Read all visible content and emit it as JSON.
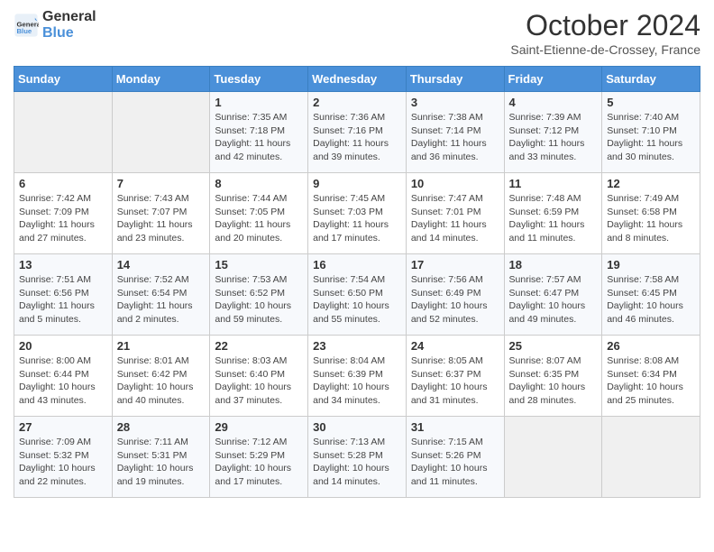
{
  "header": {
    "logo_general": "General",
    "logo_blue": "Blue",
    "month_title": "October 2024",
    "subtitle": "Saint-Etienne-de-Crossey, France"
  },
  "days_of_week": [
    "Sunday",
    "Monday",
    "Tuesday",
    "Wednesday",
    "Thursday",
    "Friday",
    "Saturday"
  ],
  "weeks": [
    [
      {
        "day": "",
        "info": ""
      },
      {
        "day": "",
        "info": ""
      },
      {
        "day": "1",
        "info": "Sunrise: 7:35 AM\nSunset: 7:18 PM\nDaylight: 11 hours and 42 minutes."
      },
      {
        "day": "2",
        "info": "Sunrise: 7:36 AM\nSunset: 7:16 PM\nDaylight: 11 hours and 39 minutes."
      },
      {
        "day": "3",
        "info": "Sunrise: 7:38 AM\nSunset: 7:14 PM\nDaylight: 11 hours and 36 minutes."
      },
      {
        "day": "4",
        "info": "Sunrise: 7:39 AM\nSunset: 7:12 PM\nDaylight: 11 hours and 33 minutes."
      },
      {
        "day": "5",
        "info": "Sunrise: 7:40 AM\nSunset: 7:10 PM\nDaylight: 11 hours and 30 minutes."
      }
    ],
    [
      {
        "day": "6",
        "info": "Sunrise: 7:42 AM\nSunset: 7:09 PM\nDaylight: 11 hours and 27 minutes."
      },
      {
        "day": "7",
        "info": "Sunrise: 7:43 AM\nSunset: 7:07 PM\nDaylight: 11 hours and 23 minutes."
      },
      {
        "day": "8",
        "info": "Sunrise: 7:44 AM\nSunset: 7:05 PM\nDaylight: 11 hours and 20 minutes."
      },
      {
        "day": "9",
        "info": "Sunrise: 7:45 AM\nSunset: 7:03 PM\nDaylight: 11 hours and 17 minutes."
      },
      {
        "day": "10",
        "info": "Sunrise: 7:47 AM\nSunset: 7:01 PM\nDaylight: 11 hours and 14 minutes."
      },
      {
        "day": "11",
        "info": "Sunrise: 7:48 AM\nSunset: 6:59 PM\nDaylight: 11 hours and 11 minutes."
      },
      {
        "day": "12",
        "info": "Sunrise: 7:49 AM\nSunset: 6:58 PM\nDaylight: 11 hours and 8 minutes."
      }
    ],
    [
      {
        "day": "13",
        "info": "Sunrise: 7:51 AM\nSunset: 6:56 PM\nDaylight: 11 hours and 5 minutes."
      },
      {
        "day": "14",
        "info": "Sunrise: 7:52 AM\nSunset: 6:54 PM\nDaylight: 11 hours and 2 minutes."
      },
      {
        "day": "15",
        "info": "Sunrise: 7:53 AM\nSunset: 6:52 PM\nDaylight: 10 hours and 59 minutes."
      },
      {
        "day": "16",
        "info": "Sunrise: 7:54 AM\nSunset: 6:50 PM\nDaylight: 10 hours and 55 minutes."
      },
      {
        "day": "17",
        "info": "Sunrise: 7:56 AM\nSunset: 6:49 PM\nDaylight: 10 hours and 52 minutes."
      },
      {
        "day": "18",
        "info": "Sunrise: 7:57 AM\nSunset: 6:47 PM\nDaylight: 10 hours and 49 minutes."
      },
      {
        "day": "19",
        "info": "Sunrise: 7:58 AM\nSunset: 6:45 PM\nDaylight: 10 hours and 46 minutes."
      }
    ],
    [
      {
        "day": "20",
        "info": "Sunrise: 8:00 AM\nSunset: 6:44 PM\nDaylight: 10 hours and 43 minutes."
      },
      {
        "day": "21",
        "info": "Sunrise: 8:01 AM\nSunset: 6:42 PM\nDaylight: 10 hours and 40 minutes."
      },
      {
        "day": "22",
        "info": "Sunrise: 8:03 AM\nSunset: 6:40 PM\nDaylight: 10 hours and 37 minutes."
      },
      {
        "day": "23",
        "info": "Sunrise: 8:04 AM\nSunset: 6:39 PM\nDaylight: 10 hours and 34 minutes."
      },
      {
        "day": "24",
        "info": "Sunrise: 8:05 AM\nSunset: 6:37 PM\nDaylight: 10 hours and 31 minutes."
      },
      {
        "day": "25",
        "info": "Sunrise: 8:07 AM\nSunset: 6:35 PM\nDaylight: 10 hours and 28 minutes."
      },
      {
        "day": "26",
        "info": "Sunrise: 8:08 AM\nSunset: 6:34 PM\nDaylight: 10 hours and 25 minutes."
      }
    ],
    [
      {
        "day": "27",
        "info": "Sunrise: 7:09 AM\nSunset: 5:32 PM\nDaylight: 10 hours and 22 minutes."
      },
      {
        "day": "28",
        "info": "Sunrise: 7:11 AM\nSunset: 5:31 PM\nDaylight: 10 hours and 19 minutes."
      },
      {
        "day": "29",
        "info": "Sunrise: 7:12 AM\nSunset: 5:29 PM\nDaylight: 10 hours and 17 minutes."
      },
      {
        "day": "30",
        "info": "Sunrise: 7:13 AM\nSunset: 5:28 PM\nDaylight: 10 hours and 14 minutes."
      },
      {
        "day": "31",
        "info": "Sunrise: 7:15 AM\nSunset: 5:26 PM\nDaylight: 10 hours and 11 minutes."
      },
      {
        "day": "",
        "info": ""
      },
      {
        "day": "",
        "info": ""
      }
    ]
  ]
}
